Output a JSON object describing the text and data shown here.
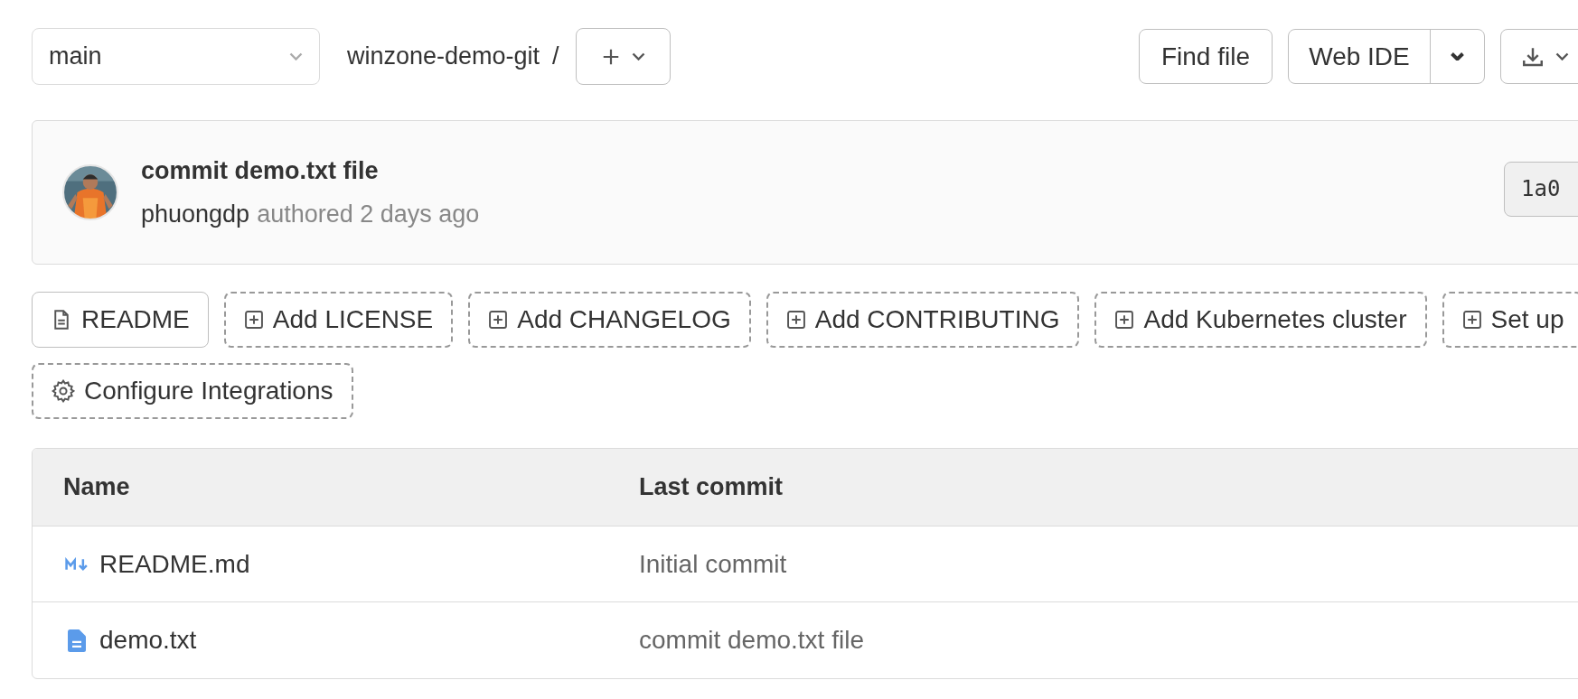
{
  "branch_select": {
    "value": "main"
  },
  "breadcrumb": {
    "project": "winzone-demo-git",
    "separator": "/"
  },
  "actions": {
    "find_file": "Find file",
    "web_ide": "Web IDE"
  },
  "commit": {
    "title": "commit demo.txt file",
    "author": "phuongdp",
    "meta": "authored 2 days ago",
    "sha": "1a0"
  },
  "shortcut_rows": [
    [
      {
        "label": "README",
        "kind": "file"
      },
      {
        "label": "Add LICENSE",
        "kind": "add"
      },
      {
        "label": "Add CHANGELOG",
        "kind": "add"
      },
      {
        "label": "Add CONTRIBUTING",
        "kind": "add"
      },
      {
        "label": "Add Kubernetes cluster",
        "kind": "add"
      },
      {
        "label": "Set up",
        "kind": "add"
      }
    ],
    [
      {
        "label": "Configure Integrations",
        "kind": "settings"
      }
    ]
  ],
  "table": {
    "columns": [
      "Name",
      "Last commit"
    ],
    "rows": [
      {
        "name": "README.md",
        "kind": "markdown",
        "last_commit": "Initial commit"
      },
      {
        "name": "demo.txt",
        "kind": "text",
        "last_commit": "commit demo.txt file"
      }
    ]
  }
}
